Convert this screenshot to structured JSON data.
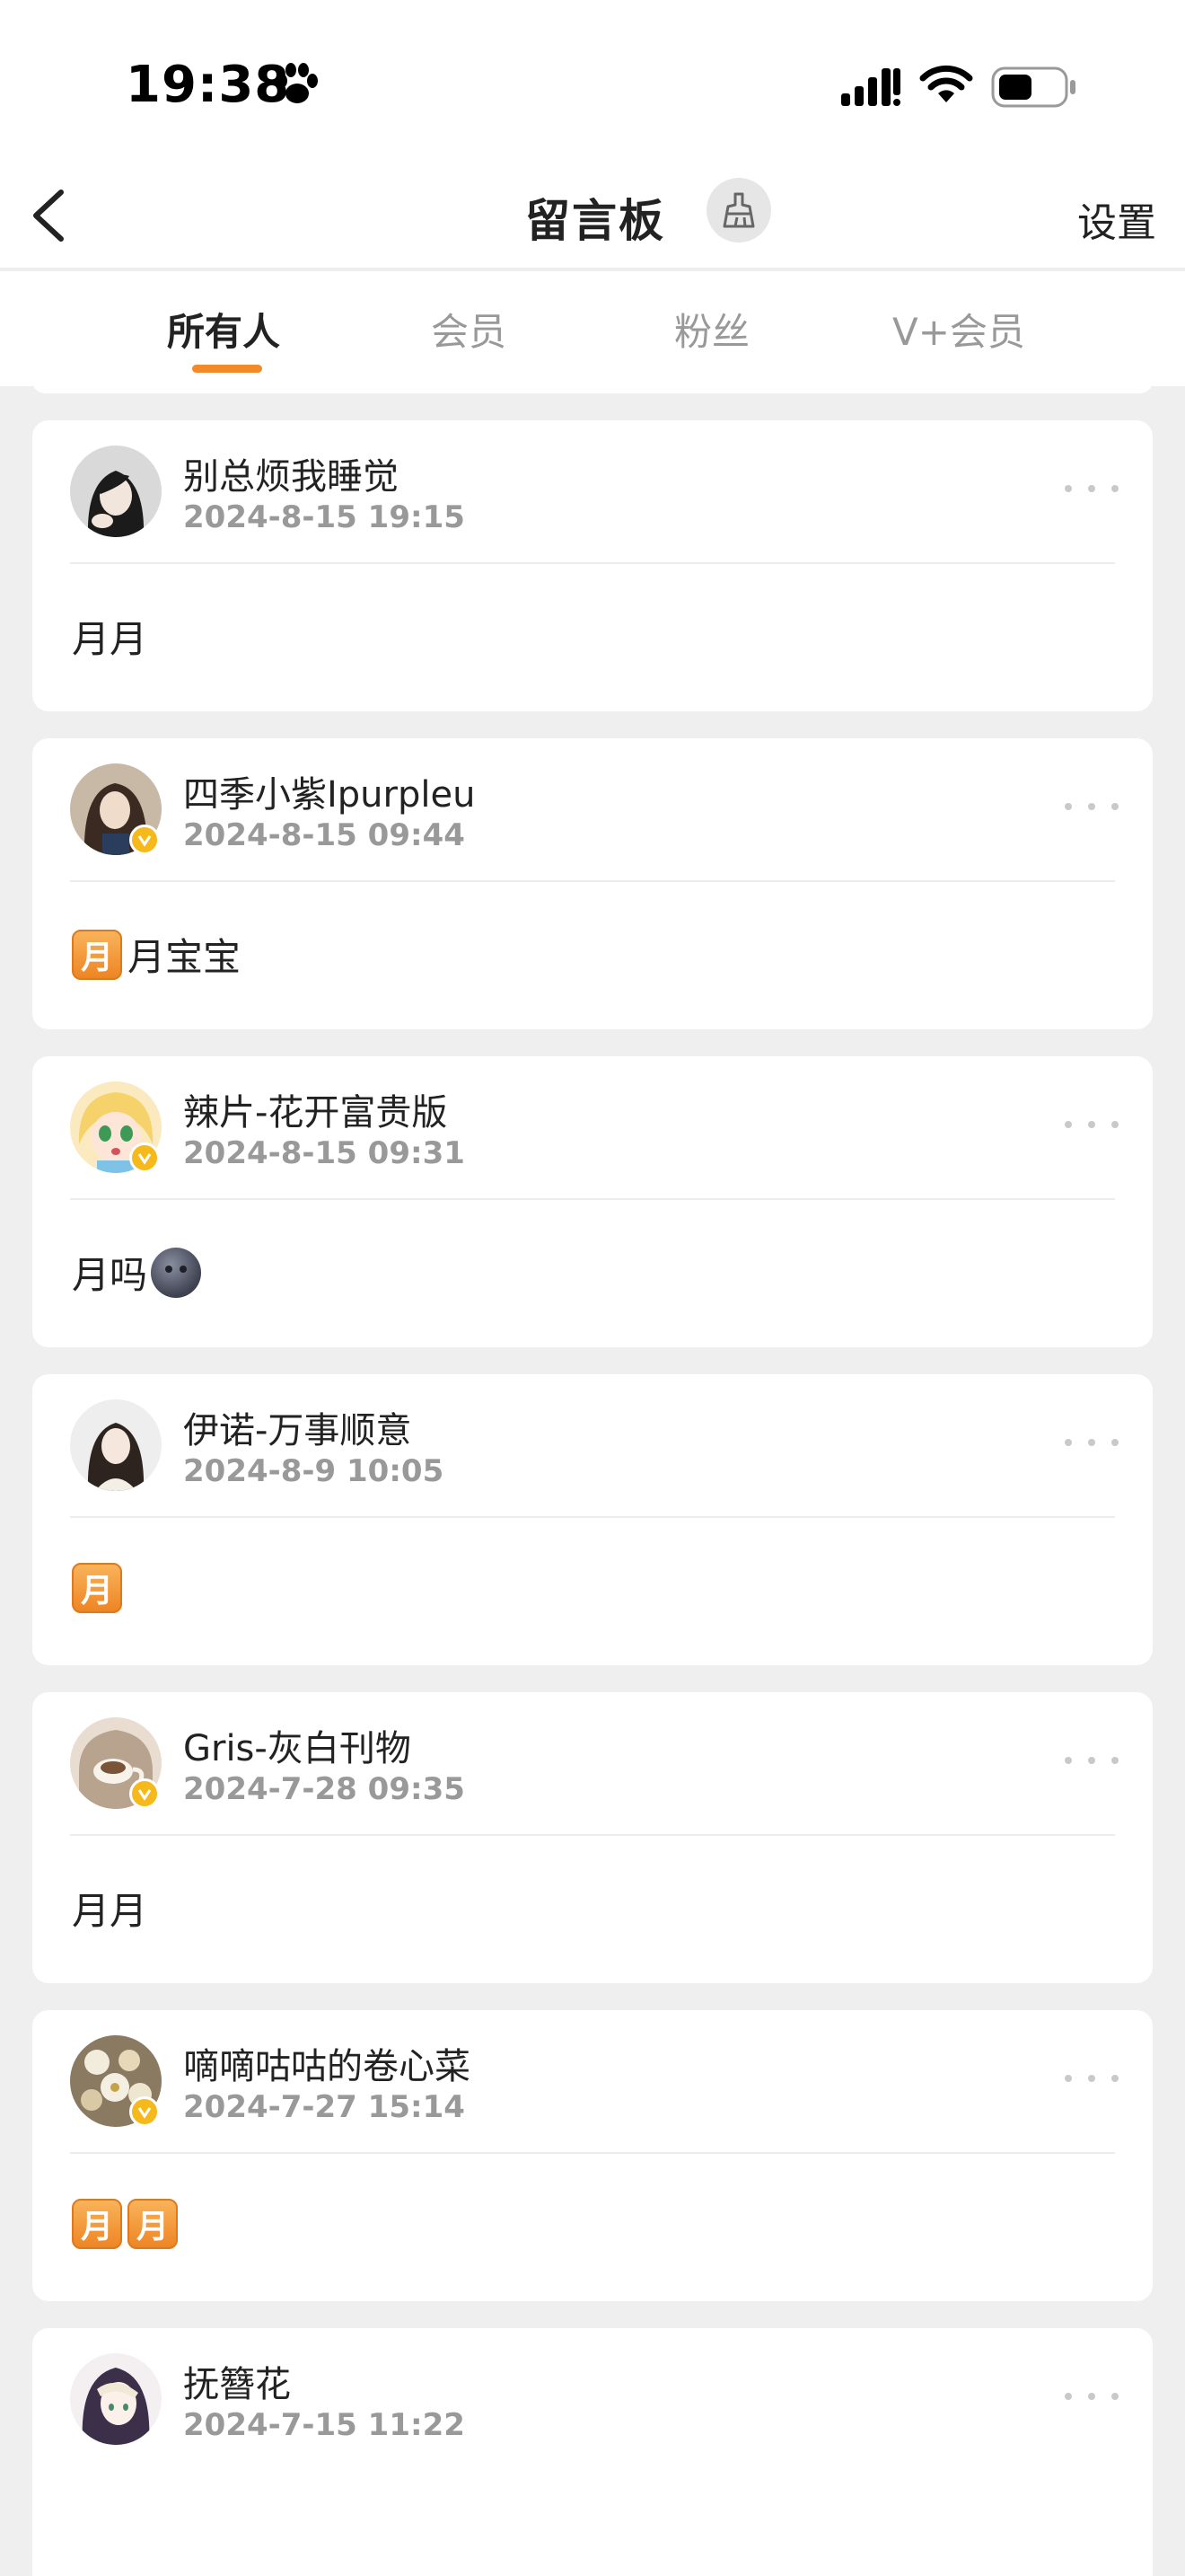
{
  "status_bar": {
    "time": "19:38"
  },
  "nav": {
    "title": "留言板",
    "settings_label": "设置",
    "icons": [
      "back-arrow-icon",
      "broom-icon"
    ]
  },
  "tabs": [
    {
      "label": "所有人",
      "active": true
    },
    {
      "label": "会员",
      "active": false
    },
    {
      "label": "粉丝",
      "active": false
    },
    {
      "label": "V+会员",
      "active": false
    }
  ],
  "colors": {
    "accent": "#f38a2a",
    "verified_badge": "#f6b91c",
    "background": "#efefef",
    "secondary_text": "#999999"
  },
  "messages": [
    {
      "username": "别总烦我睡觉",
      "time": "2024-8-15 19:15",
      "verified": false,
      "text": "月月",
      "emojis": []
    },
    {
      "username": "四季小紫Ipurpleu",
      "time": "2024-8-15 09:44",
      "verified": true,
      "text": "月宝宝",
      "emojis": [
        "月"
      ]
    },
    {
      "username": "辣片-花开富贵版",
      "time": "2024-8-15 09:31",
      "verified": true,
      "text": "月吗",
      "emojis": [
        "moon-face"
      ]
    },
    {
      "username": "伊诺-万事顺意",
      "time": "2024-8-9 10:05",
      "verified": false,
      "text": "",
      "emojis": [
        "月"
      ]
    },
    {
      "username": "Gris-灰白刊物",
      "time": "2024-7-28 09:35",
      "verified": true,
      "text": "月月",
      "emojis": []
    },
    {
      "username": "嘀嘀咕咕的卷心菜",
      "time": "2024-7-27 15:14",
      "verified": true,
      "text": "",
      "emojis": [
        "月",
        "月"
      ]
    },
    {
      "username": "抚簪花",
      "time": "2024-7-15 11:22",
      "verified": false,
      "text": "",
      "emojis": []
    }
  ]
}
